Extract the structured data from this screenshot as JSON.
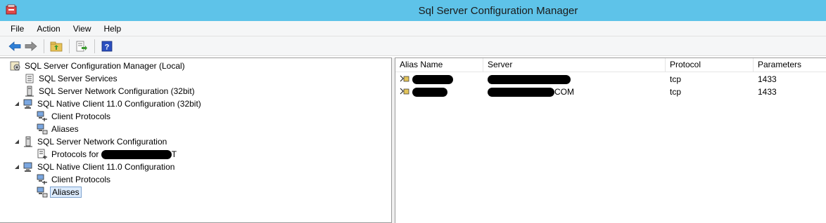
{
  "window": {
    "title": "Sql Server Configuration Manager"
  },
  "menu": {
    "items": [
      "File",
      "Action",
      "View",
      "Help"
    ]
  },
  "toolbar": {
    "buttons": [
      "back-icon",
      "forward-icon",
      "up-folder-icon",
      "export-list-icon",
      "help-icon"
    ]
  },
  "tree": {
    "root": "SQL Server Configuration Manager (Local)",
    "items": [
      {
        "label": "SQL Server Services"
      },
      {
        "label": "SQL Server Network Configuration (32bit)"
      },
      {
        "label": "SQL Native Client 11.0 Configuration (32bit)"
      },
      {
        "label": "Client Protocols"
      },
      {
        "label": "Aliases"
      },
      {
        "label": "SQL Server Network Configuration"
      },
      {
        "label": "Protocols for"
      },
      {
        "label": "T"
      },
      {
        "label": "SQL Native Client 11.0 Configuration"
      },
      {
        "label": "Client Protocols"
      },
      {
        "label": "Aliases"
      }
    ]
  },
  "list": {
    "columns": [
      "Alias Name",
      "Server",
      "Protocol",
      "Parameters"
    ],
    "rows": [
      {
        "alias": "",
        "server": "",
        "protocol": "tcp",
        "parameters": "1433"
      },
      {
        "alias": "",
        "server": "COM",
        "protocol": "tcp",
        "parameters": "1433"
      }
    ]
  }
}
